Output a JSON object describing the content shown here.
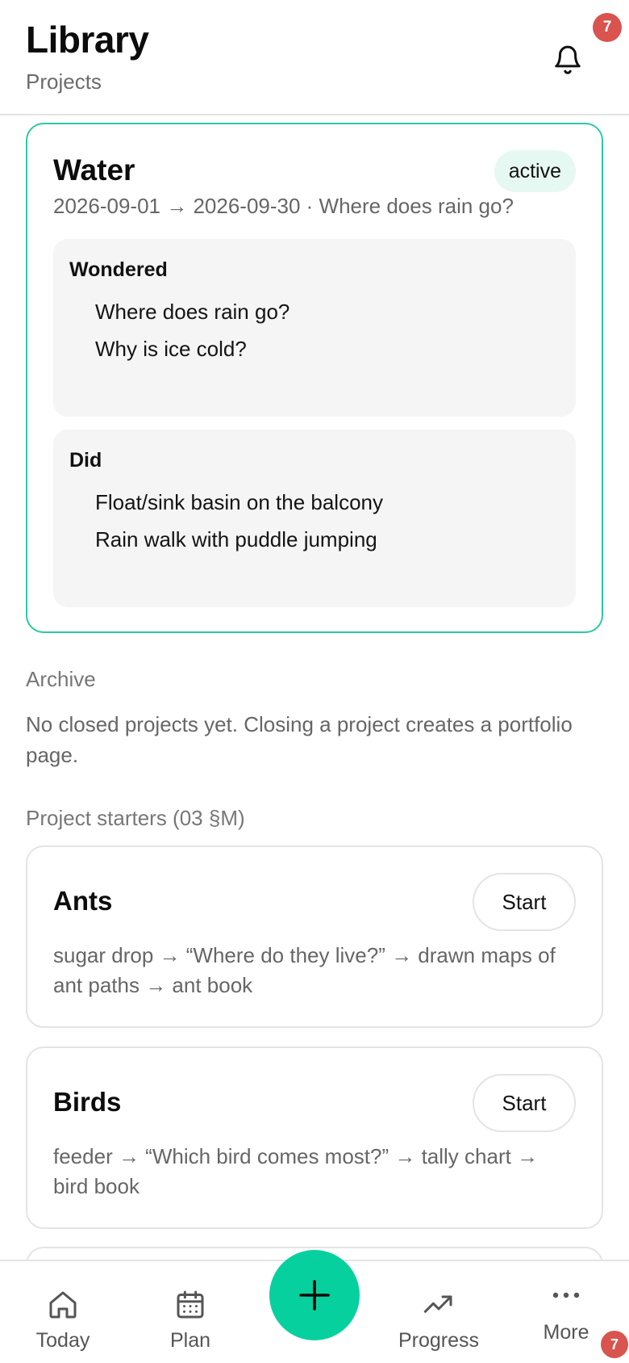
{
  "header": {
    "title": "Library",
    "subtitle": "Projects",
    "notification_count": "7"
  },
  "active_project": {
    "name": "Water",
    "status": "active",
    "meta": "2026-09-01 → 2026-09-30 · Where does rain go?",
    "sections": [
      {
        "label": "Wondered",
        "items": [
          "Where does rain go?",
          "Why is ice cold?"
        ]
      },
      {
        "label": "Did",
        "items": [
          "Float/sink basin on the balcony",
          "Rain walk with puddle jumping"
        ]
      }
    ]
  },
  "archive": {
    "title": "Archive",
    "empty_text": "No closed projects yet. Closing a project creates a portfolio page."
  },
  "starters": {
    "title": "Project starters (03 §M)",
    "start_label": "Start",
    "items": [
      {
        "name": "Ants",
        "description": "sugar drop → “Where do they live?” → drawn maps of ant paths → ant book"
      },
      {
        "name": "Birds",
        "description": "feeder → “Which bird comes most?” → tally chart → bird book"
      }
    ]
  },
  "nav": {
    "today": "Today",
    "plan": "Plan",
    "progress": "Progress",
    "more": "More",
    "more_badge": "7"
  },
  "colors": {
    "accent": "#06d19e",
    "active_border": "#2cc9a4",
    "badge": "#d9534f"
  }
}
